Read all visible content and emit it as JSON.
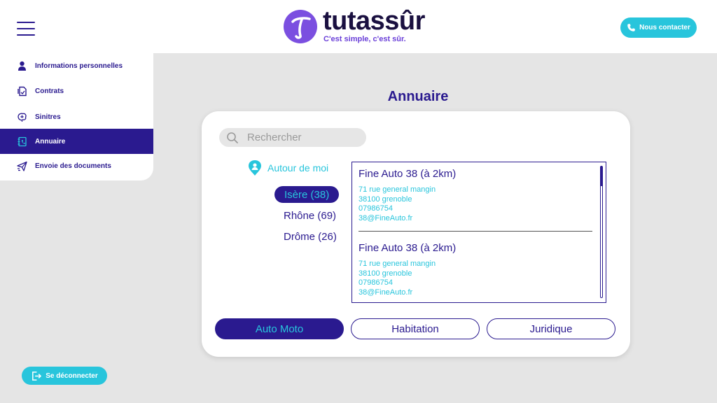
{
  "header": {
    "brand_name": "tutassûr",
    "tagline": "C'est simple, c'est sûr.",
    "contact_label": "Nous contacter"
  },
  "sidebar": {
    "items": [
      {
        "label": "Informations personnelles",
        "icon": "user-icon"
      },
      {
        "label": "Contrats",
        "icon": "contract-icon"
      },
      {
        "label": "Sinitres",
        "icon": "claim-icon"
      },
      {
        "label": "Annuaire",
        "icon": "directory-icon",
        "active": true
      },
      {
        "label": "Envoie des documents",
        "icon": "send-icon"
      }
    ],
    "logout_label": "Se déconnecter"
  },
  "main": {
    "title": "Annuaire",
    "search": {
      "placeholder": "Rechercher",
      "value": ""
    },
    "near_me_label": "Autour de moi",
    "departments": [
      {
        "label": "Isère (38)",
        "active": true
      },
      {
        "label": "Rhône (69)"
      },
      {
        "label": "Drôme (26)"
      }
    ],
    "results": [
      {
        "name": "Fine Auto 38 (à 2km)",
        "street": "71 rue general mangin",
        "city": "38100 grenoble",
        "phone": "07986754",
        "email": "38@FineAuto.fr"
      },
      {
        "name": "Fine Auto 38 (à 2km)",
        "street": "71 rue general mangin",
        "city": "38100 grenoble",
        "phone": "07986754",
        "email": "38@FineAuto.fr"
      }
    ],
    "categories": [
      {
        "label": "Auto Moto",
        "active": true
      },
      {
        "label": "Habitation"
      },
      {
        "label": "Juridique"
      }
    ]
  },
  "colors": {
    "primary": "#2a1a8f",
    "accent": "#28c5dc",
    "brand_purple": "#7b4fe0",
    "background": "#e5e5e5"
  }
}
